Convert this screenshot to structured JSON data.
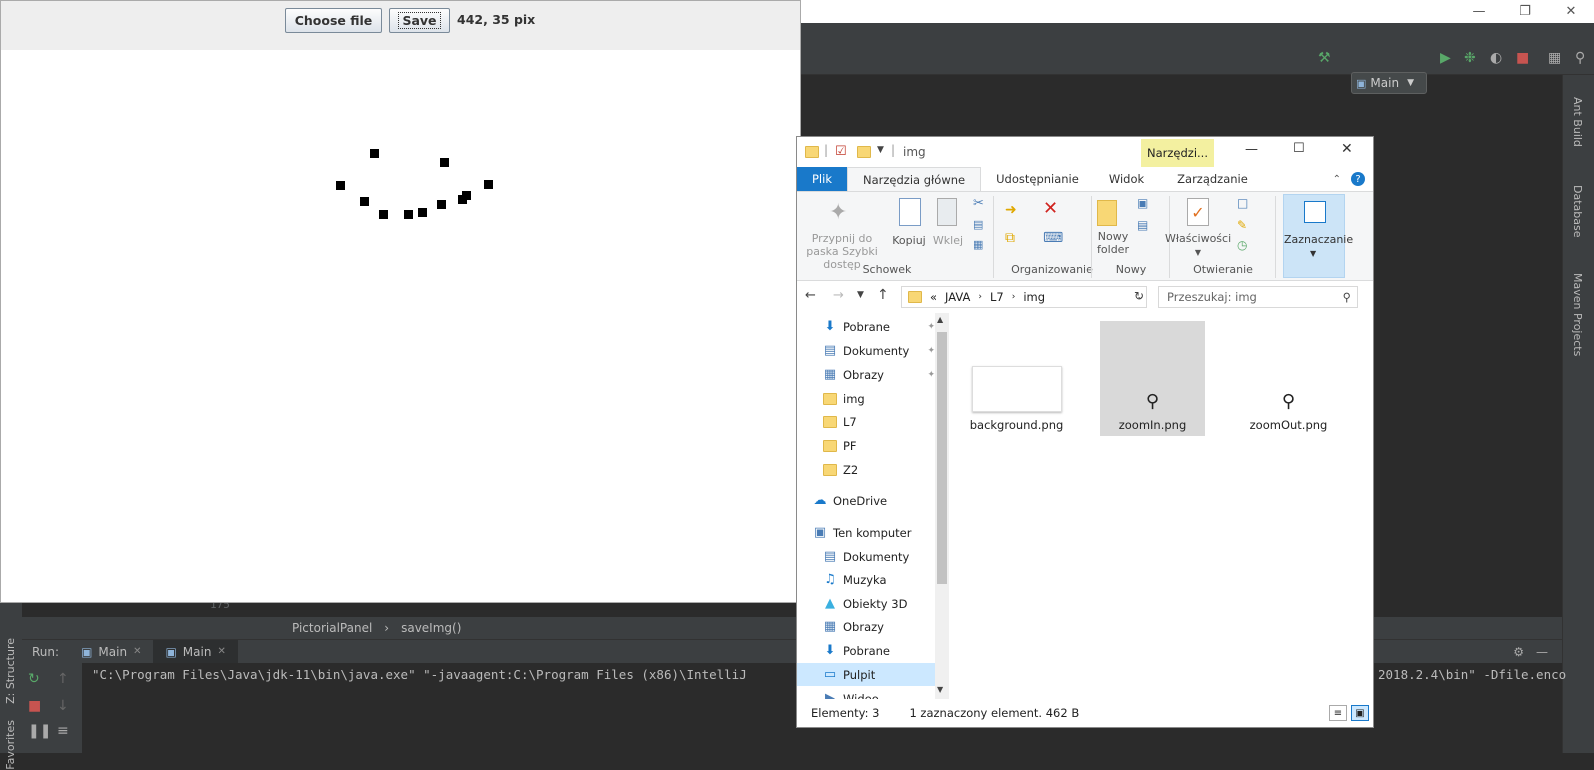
{
  "java_app": {
    "choose_file_label": "Choose file",
    "save_label": "Save",
    "coords_text": "442, 35 pix"
  },
  "ide": {
    "run_config": "Main",
    "side_tabs": [
      "Ant Build",
      "Database",
      "Maven Projects"
    ],
    "left_tabs": [
      "Z: Structure",
      "Favorites"
    ],
    "line_number": "175",
    "breadcrumb": [
      "PictorialPanel",
      "saveImg()"
    ],
    "run_label": "Run:",
    "run_tabs": [
      "Main",
      "Main"
    ],
    "console_text": "\"C:\\Program Files\\Java\\jdk-11\\bin\\java.exe\" \"-javaagent:C:\\Program Files (x86)\\IntelliJ",
    "console_text_right": "2018.2.4\\bin\" -Dfile.enco"
  },
  "explorer": {
    "title": "img",
    "context_tab": "Narzędzi...",
    "tabs": [
      "Plik",
      "Narzędzia główne",
      "Udostępnianie",
      "Widok",
      "Zarządzanie"
    ],
    "ribbon": {
      "pin_label": "Przypnij do paska Szybki dostęp",
      "copy_label": "Kopiuj",
      "paste_label": "Wklej",
      "group_clipboard": "Schowek",
      "group_organize": "Organizowanie",
      "new_folder_label": "Nowy folder",
      "group_new": "Nowy",
      "properties_label": "Właściwości",
      "group_open": "Otwieranie",
      "select_label": "Zaznaczanie"
    },
    "address": [
      "«",
      "JAVA",
      "L7",
      "img"
    ],
    "search_placeholder": "Przeszukaj: img",
    "nav_items": [
      {
        "label": "Pobrane",
        "icon": "download-icon",
        "pinned": true
      },
      {
        "label": "Dokumenty",
        "icon": "documents-icon",
        "pinned": true
      },
      {
        "label": "Obrazy",
        "icon": "pictures-icon",
        "pinned": true
      },
      {
        "label": "img",
        "icon": "folder-icon"
      },
      {
        "label": "L7",
        "icon": "folder-icon"
      },
      {
        "label": "PF",
        "icon": "folder-icon"
      },
      {
        "label": "Z2",
        "icon": "folder-icon"
      },
      {
        "label": "OneDrive",
        "icon": "cloud-icon"
      },
      {
        "label": "Ten komputer",
        "icon": "computer-icon"
      },
      {
        "label": "Dokumenty",
        "icon": "documents-icon"
      },
      {
        "label": "Muzyka",
        "icon": "music-icon"
      },
      {
        "label": "Obiekty 3D",
        "icon": "cube-icon"
      },
      {
        "label": "Obrazy",
        "icon": "pictures-icon"
      },
      {
        "label": "Pobrane",
        "icon": "download-icon"
      },
      {
        "label": "Pulpit",
        "icon": "desktop-icon",
        "selected": true
      },
      {
        "label": "Wideo",
        "icon": "video-icon"
      }
    ],
    "files": [
      {
        "name": "background.png",
        "selected": false
      },
      {
        "name": "zoomIn.png",
        "selected": true
      },
      {
        "name": "zoomOut.png",
        "selected": false
      }
    ],
    "status_count": "Elementy: 3",
    "status_selected": "1 zaznaczony element. 462 B"
  },
  "colors": {
    "ide_bg": "#2b2b2b",
    "ide_panel": "#3c3f41",
    "explorer_accent": "#1979ca",
    "context_tab_bg": "#f3f0a0"
  }
}
